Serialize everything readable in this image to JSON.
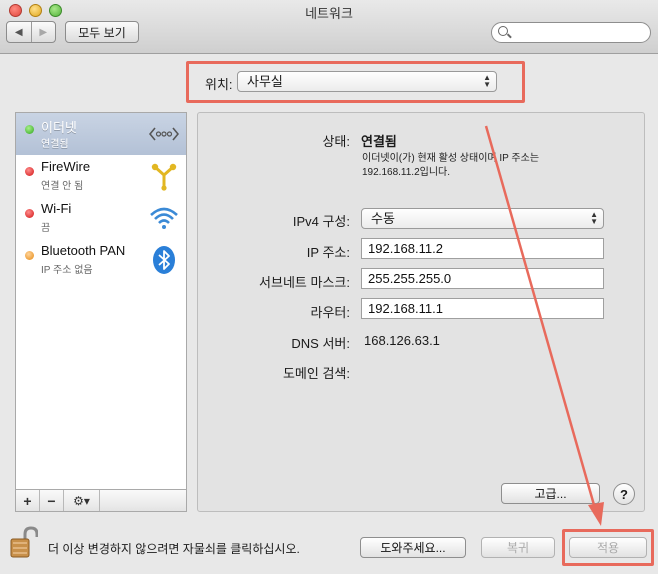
{
  "window": {
    "title": "네트워크"
  },
  "toolbar": {
    "back_glyph": "◀",
    "forward_glyph": "▶",
    "show_all_label": "모두 보기",
    "search_placeholder": ""
  },
  "location": {
    "label": "위치:",
    "value": "사무실"
  },
  "services": [
    {
      "name": "이더넷",
      "status": "연결됨",
      "dot": "green",
      "icon": "ethernet-icon",
      "selected": true
    },
    {
      "name": "FireWire",
      "status": "연결 안 됨",
      "dot": "red",
      "icon": "firewire-icon",
      "selected": false
    },
    {
      "name": "Wi-Fi",
      "status": "끔",
      "dot": "red",
      "icon": "wifi-icon",
      "selected": false
    },
    {
      "name": "Bluetooth PAN",
      "status": "IP 주소 없음",
      "dot": "amber",
      "icon": "bluetooth-icon",
      "selected": false
    }
  ],
  "sidebar_tools": {
    "add": "+",
    "remove": "−",
    "gear": "⚙▾"
  },
  "details": {
    "status_label": "상태:",
    "status_value": "연결됨",
    "status_desc_line1": "이더넷이(가) 현재 활성 상태이며 IP 주소는",
    "status_desc_line2": "192.168.11.2입니다.",
    "ipv4_label": "IPv4 구성:",
    "ipv4_value": "수동",
    "ip_label": "IP 주소:",
    "ip_value": "192.168.11.2",
    "subnet_label": "서브네트 마스크:",
    "subnet_value": "255.255.255.0",
    "router_label": "라우터:",
    "router_value": "192.168.11.1",
    "dns_label": "DNS 서버:",
    "dns_value": "168.126.63.1",
    "domain_label": "도메인 검색:",
    "advanced_label": "고급...",
    "help_label": "?"
  },
  "footer": {
    "lock_text": "더 이상 변경하지 않으려면 자물쇠를 클릭하십시오.",
    "assist_label": "도와주세요...",
    "revert_label": "복귀",
    "apply_label": "적용"
  },
  "colors": {
    "highlight": "#e86a5c",
    "selection": "#b8c6da"
  }
}
